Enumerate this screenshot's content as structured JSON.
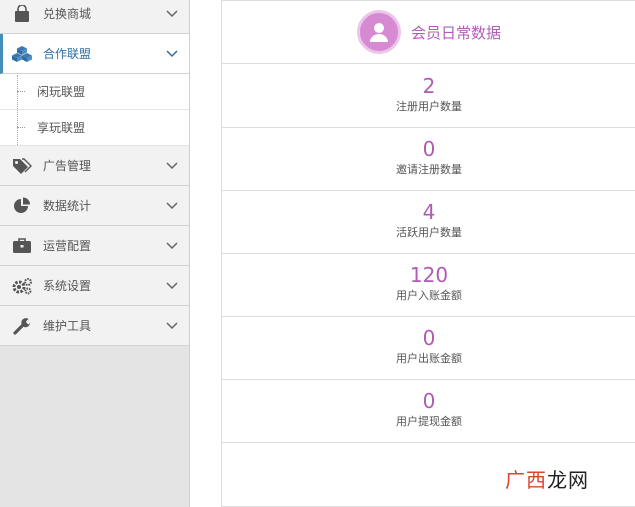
{
  "sidebar": {
    "items": [
      {
        "label": "兑换商城",
        "icon": "shopping-bag-icon"
      },
      {
        "label": "合作联盟",
        "icon": "cubes-icon",
        "expanded": true,
        "children": [
          {
            "label": "闲玩联盟"
          },
          {
            "label": "享玩联盟"
          }
        ]
      },
      {
        "label": "广告管理",
        "icon": "tags-icon"
      },
      {
        "label": "数据统计",
        "icon": "pie-chart-icon"
      },
      {
        "label": "运营配置",
        "icon": "briefcase-icon"
      },
      {
        "label": "系统设置",
        "icon": "cogs-icon"
      },
      {
        "label": "维护工具",
        "icon": "wrench-icon"
      }
    ]
  },
  "panel": {
    "title": "会员日常数据",
    "icon": "user-icon",
    "stats": [
      {
        "value": "2",
        "label": "注册用户数量"
      },
      {
        "value": "0",
        "label": "邀请注册数量"
      },
      {
        "value": "4",
        "label": "活跃用户数量"
      },
      {
        "value": "120",
        "label": "用户入账金额"
      },
      {
        "value": "0",
        "label": "用户出账金额"
      },
      {
        "value": "0",
        "label": "用户提现金额"
      }
    ]
  },
  "watermark": {
    "part1": "广西",
    "part2": "龙网"
  },
  "colors": {
    "accent": "#b05bb5",
    "active_border": "#438eb9"
  }
}
